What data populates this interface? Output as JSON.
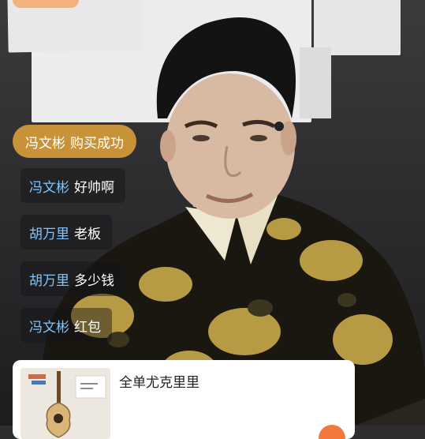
{
  "chat": {
    "purchase": {
      "user": "冯文彬",
      "text": "购买成功"
    },
    "messages": [
      {
        "user": "冯文彬",
        "text": "好帅啊"
      },
      {
        "user": "胡万里",
        "text": "老板"
      },
      {
        "user": "胡万里",
        "text": "多少钱"
      },
      {
        "user": "冯文彬",
        "text": "红包"
      }
    ]
  },
  "product": {
    "title": "全单尤克里里"
  },
  "colors": {
    "purchase_bg": "#c89238",
    "username": "#7fc6ff",
    "cart_button": "#f2793e"
  }
}
